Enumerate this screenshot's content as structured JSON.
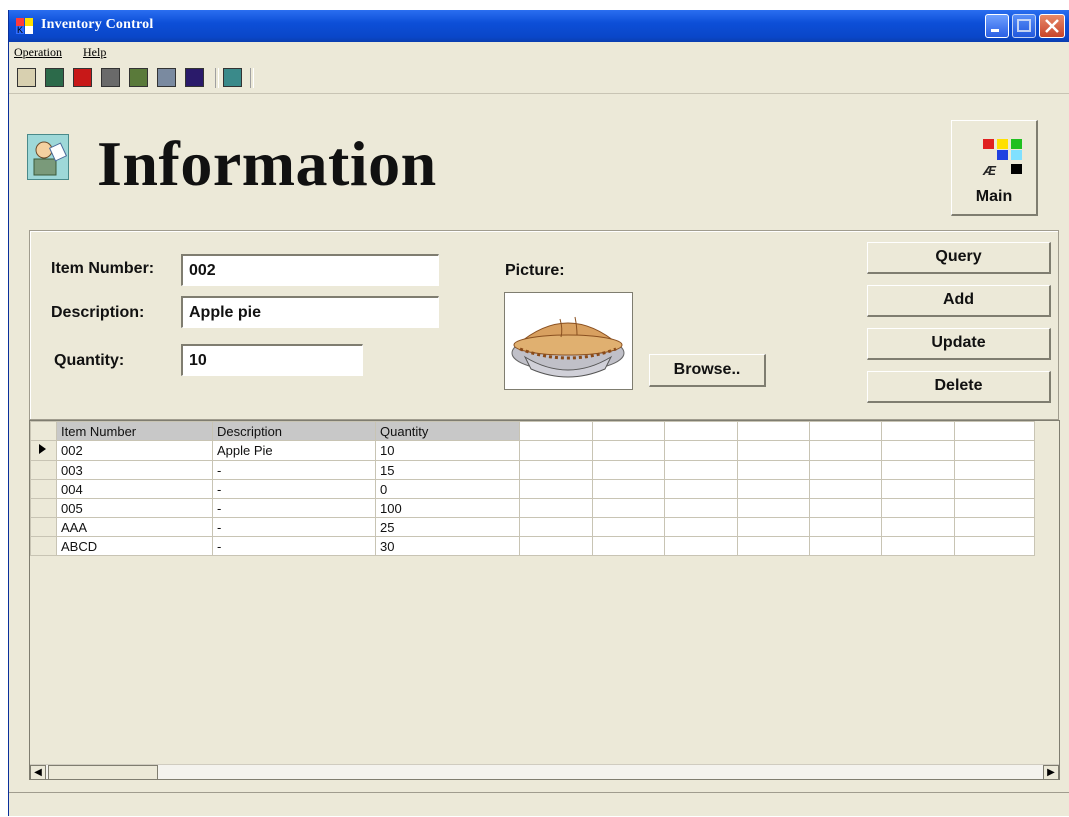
{
  "window": {
    "title": "Inventory Control"
  },
  "menu": [
    "Operation",
    "Help"
  ],
  "toolbar": {
    "icons": [
      "printer-icon",
      "form-icon",
      "record-icon",
      "disk-icon",
      "chart-icon",
      "photo-icon",
      "book-icon",
      "exit-icon"
    ]
  },
  "header": {
    "title": "Information"
  },
  "main_button": {
    "label": "Main"
  },
  "form": {
    "item_number_label": "Item Number:",
    "item_number_value": "002",
    "description_label": "Description:",
    "description_value": "Apple pie",
    "quantity_label": "Quantity:",
    "quantity_value": "10",
    "picture_label": "Picture:",
    "browse_label": "Browse.."
  },
  "actions": {
    "query": "Query",
    "add": "Add",
    "update": "Update",
    "delete": "Delete"
  },
  "grid": {
    "columns": [
      "Item Number",
      "Description",
      "Quantity"
    ],
    "rows": [
      [
        "002",
        "Apple Pie",
        "10"
      ],
      [
        "003",
        "-",
        "15"
      ],
      [
        "004",
        "-",
        "0"
      ],
      [
        "005",
        "-",
        "100"
      ],
      [
        "AAA",
        "-",
        "25"
      ],
      [
        "ABCD",
        "-",
        "30"
      ]
    ],
    "selected_row": 0
  },
  "colors": {
    "titlebar": "#0a46c8",
    "window_bg": "#ece9d8",
    "header_cell": "#c8c8c8"
  }
}
